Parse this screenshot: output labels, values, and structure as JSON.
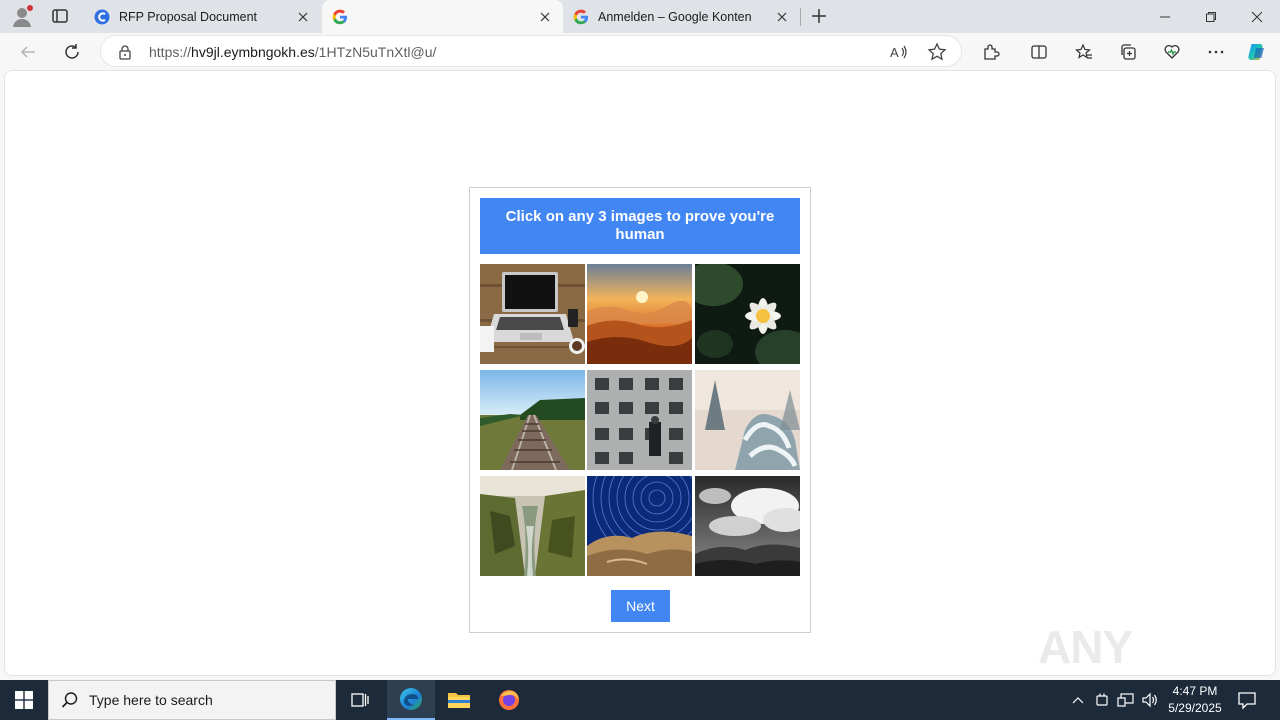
{
  "browser": {
    "tabs": [
      {
        "title": "RFP Proposal Document",
        "favicon": "copilot-c-icon",
        "active": false
      },
      {
        "title": "",
        "favicon": "google-g-icon",
        "active": true
      },
      {
        "title": "Anmelden – Google Konten",
        "favicon": "google-g-icon",
        "active": false
      }
    ],
    "address": {
      "prefix": "https://",
      "host": "hv9jl.eymbngokh.es",
      "path": "/1HTzN5uTnXtl@u/"
    }
  },
  "captcha": {
    "header": "Click on any 3 images to prove you're human",
    "tiles": [
      {
        "subject": "laptop on wooden desk"
      },
      {
        "subject": "sunset above clouds"
      },
      {
        "subject": "white water lily"
      },
      {
        "subject": "railway tracks through field"
      },
      {
        "subject": "weathered building facade"
      },
      {
        "subject": "snowy fir trees in mist"
      },
      {
        "subject": "mossy river canyon"
      },
      {
        "subject": "star trails over rocks"
      },
      {
        "subject": "black and white clouds over hills"
      }
    ],
    "next_label": "Next"
  },
  "watermark": "ANY RUN",
  "taskbar": {
    "search_placeholder": "Type here to search",
    "time": "4:47 PM",
    "date": "5/29/2025"
  },
  "colors": {
    "accent": "#4286f4",
    "taskbar": "#1c2a3a",
    "tabstrip": "#dfe3e8"
  }
}
